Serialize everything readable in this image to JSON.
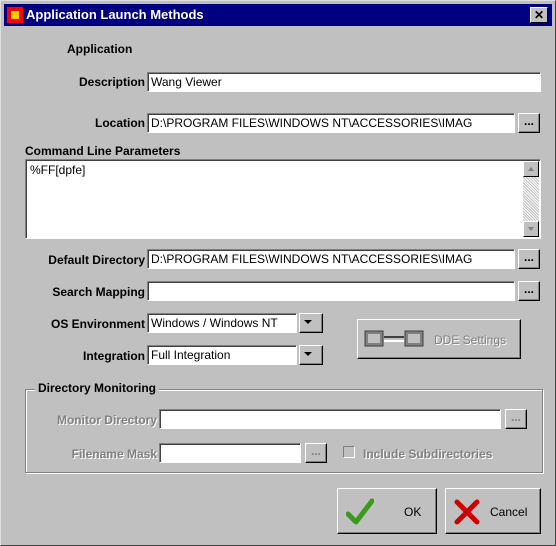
{
  "window": {
    "title": "Application Launch Methods"
  },
  "labels": {
    "application": "Application",
    "description": "Description",
    "location": "Location",
    "command_line": "Command Line Parameters",
    "default_directory": "Default Directory",
    "search_mapping": "Search Mapping",
    "os_environment": "OS Environment",
    "integration": "Integration",
    "directory_monitoring": "Directory Monitoring",
    "monitor_directory": "Monitor Directory",
    "filename_mask": "Filename Mask",
    "include_subdirectories": "Include Subdirectories"
  },
  "values": {
    "description": "Wang Viewer",
    "location": "D:\\PROGRAM FILES\\WINDOWS NT\\ACCESSORIES\\IMAG",
    "command_line": "%FF[dpfe]",
    "default_directory": "D:\\PROGRAM FILES\\WINDOWS NT\\ACCESSORIES\\IMAG",
    "search_mapping": "",
    "os_environment": "Windows / Windows NT",
    "integration": "Full Integration",
    "monitor_directory": "",
    "filename_mask": ""
  },
  "buttons": {
    "browse": "...",
    "dde_settings": "DDE Settings",
    "ok": "OK",
    "cancel": "Cancel",
    "close": "✕"
  },
  "colors": {
    "title_bg": "#000080",
    "ok_check": "#3a9a1a",
    "cancel_x": "#cc0000"
  }
}
